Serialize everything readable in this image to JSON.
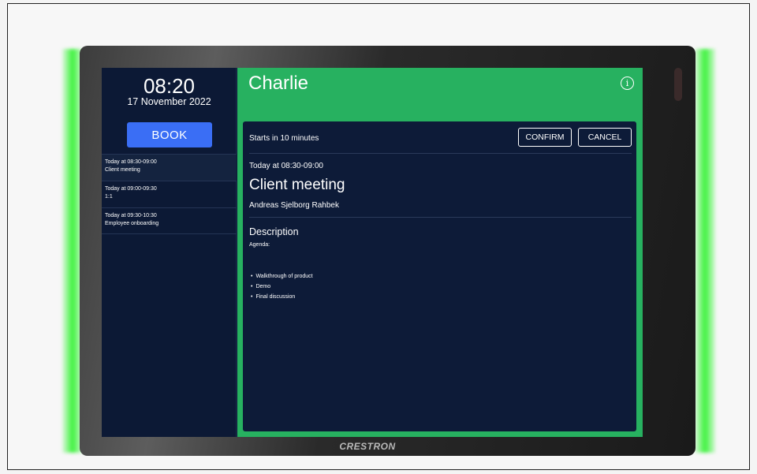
{
  "device": {
    "brand": "CRESTRON"
  },
  "sidebar": {
    "time": "08:20",
    "date": "17 November 2022",
    "book_label": "BOOK",
    "slots": [
      {
        "time": "Today at 08:30-09:00",
        "title": "Client meeting"
      },
      {
        "time": "Today at 09:00-09:30",
        "title": "1:1"
      },
      {
        "time": "Today at 09:30-10:30",
        "title": "Employee onboarding"
      }
    ]
  },
  "header": {
    "room_name": "Charlie",
    "info_glyph": "i",
    "info_icon": "info-icon"
  },
  "meeting": {
    "status": "Starts in 10 minutes",
    "confirm_label": "CONFIRM",
    "cancel_label": "CANCEL",
    "time": "Today at 08:30-09:00",
    "title": "Client meeting",
    "organizer": "Andreas Sjelborg Rahbek",
    "description_heading": "Description",
    "agenda_label": "Agenda:",
    "agenda_items": [
      "Walkthrough of product",
      "Demo",
      "Final discussion"
    ]
  },
  "colors": {
    "status_green": "#27b160",
    "book_blue": "#3a6ef5",
    "screen_navy": "#0d1b38",
    "led_green": "#3df23d"
  }
}
